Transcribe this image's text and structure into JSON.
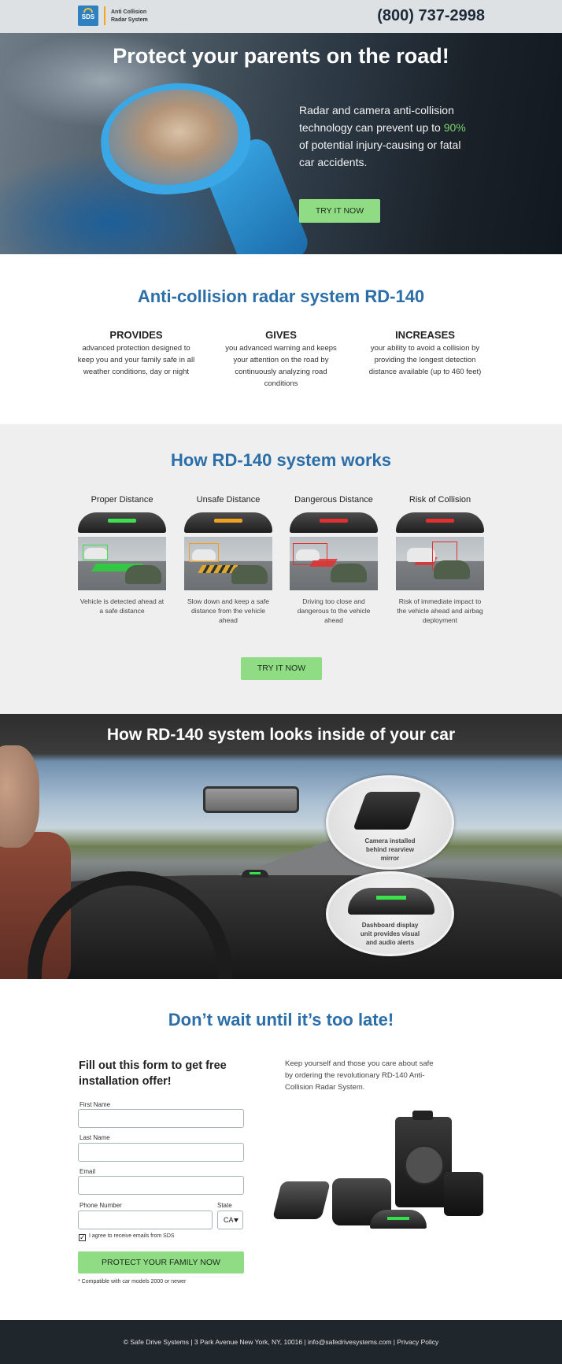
{
  "header": {
    "logo_text": "SDS",
    "brand_line1": "Anti Collision",
    "brand_line2": "Radar System",
    "phone": "(800) 737-2998"
  },
  "hero": {
    "title": "Protect your parents on the road!",
    "text_before": "Radar and camera anti-collision technology can prevent up to ",
    "highlight": "90%",
    "text_after": " of potential injury-causing or fatal car accidents.",
    "cta": "TRY IT NOW"
  },
  "features": {
    "title": "Anti-collision radar system RD-140",
    "items": [
      {
        "heading": "PROVIDES",
        "text": "advanced protection designed to keep you and your family safe in all weather conditions, day or night"
      },
      {
        "heading": "GIVES",
        "text": "you advanced warning and keeps your attention on the road by continuously analyzing road conditions"
      },
      {
        "heading": "INCREASES",
        "text": "your ability to avoid a collision by providing the longest detection distance available (up to 460 feet)"
      }
    ]
  },
  "works": {
    "title": "How RD-140 system works",
    "stages": [
      {
        "heading": "Proper Distance",
        "text": "Vehicle is detected ahead at a safe distance",
        "color": "#3ee04f"
      },
      {
        "heading": "Unsafe Distance",
        "text": "Slow down and keep a safe distance from the vehicle ahead",
        "color": "#f0a020"
      },
      {
        "heading": "Dangerous Distance",
        "text": "Driving too close and dangerous to the vehicle ahead",
        "color": "#e03030"
      },
      {
        "heading": "Risk of Collision",
        "text": "Risk of immediate impact to the vehicle ahead and airbag deployment",
        "color": "#e03030"
      }
    ],
    "cta": "TRY IT NOW"
  },
  "interior": {
    "title": "How RD-140 system looks inside of your car",
    "callout_camera": "Camera installed behind rearview mirror",
    "callout_display": "Dashboard display unit provides visual and audio alerts"
  },
  "form_section": {
    "title": "Don’t wait until it’s too late!",
    "form_heading": "Fill out this form to get free installation offer!",
    "fields": {
      "first_name_label": "First Name",
      "last_name_label": "Last Name",
      "email_label": "Email",
      "phone_label": "Phone Number",
      "state_label": "State",
      "state_value": "CA"
    },
    "checkbox_label": "I agree to receive emails from SDS",
    "submit": "PROTECT YOUR FAMILY NOW",
    "note": "* Compatible with car models 2000 or newer",
    "side_text": "Keep yourself and those you care about safe by ordering the revolutionary RD-140 Anti-Collision Radar System."
  },
  "footer": {
    "text": "© Safe Drive Systems | 3 Park Avenue New York, NY, 10016 | info@safedrivesystems.com | Privacy Policy"
  },
  "colors": {
    "accent_blue": "#2b6ea8",
    "cta_green": "#8fdc84",
    "header_bg": "#dde1e4",
    "footer_bg": "#1f262c"
  }
}
